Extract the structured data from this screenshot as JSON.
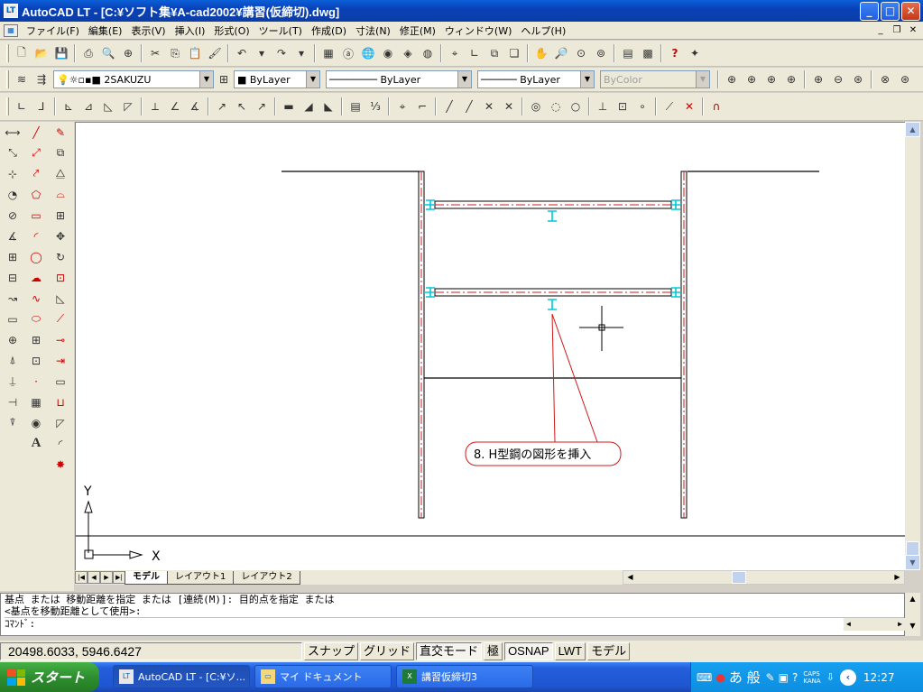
{
  "window": {
    "icon_label": "LT",
    "title": "AutoCAD LT - [C:¥ソフト集¥A-cad2002¥講習(仮締切).dwg]",
    "minimize": "_",
    "maximize": "□",
    "close": "✕"
  },
  "menu": {
    "items": [
      "ファイル(F)",
      "編集(E)",
      "表示(V)",
      "挿入(I)",
      "形式(O)",
      "ツール(T)",
      "作成(D)",
      "寸法(N)",
      "修正(M)",
      "ウィンドウ(W)",
      "ヘルプ(H)"
    ],
    "mdi_minimize": "_",
    "mdi_restore": "❐",
    "mdi_close": "✕"
  },
  "layers": {
    "current_layer": "2SAKUZU",
    "color": "ByLayer",
    "linetype": "ByLayer",
    "lineweight": "ByLayer",
    "plotstyle": "ByColor"
  },
  "drawing": {
    "callout_text": "8. H型鋼の図形を挿入",
    "ucs_y_label": "Y",
    "ucs_x_label": "X",
    "colors": {
      "outline": "#000000",
      "sheet_pile": "#d01818",
      "beam_accent": "#00c8d8",
      "callout": "#d01818"
    }
  },
  "tabs": {
    "model": "モデル",
    "layout1": "レイアウト1",
    "layout2": "レイアウト2"
  },
  "command": {
    "line1": "基点 または 移動距離を指定 または [連続(M)]: 目的点を指定 または",
    "line2": "<基点を移動距離として使用>:",
    "prompt": "ｺﾏﾝﾄﾞ:"
  },
  "status": {
    "coordinates": "20498.6033, 5946.6427",
    "toggles": [
      {
        "label": "スナップ",
        "on": false
      },
      {
        "label": "グリッド",
        "on": false
      },
      {
        "label": "直交モード",
        "on": true
      },
      {
        "label": "極",
        "on": false
      },
      {
        "label": "OSNAP",
        "on": true
      },
      {
        "label": "LWT",
        "on": false
      },
      {
        "label": "モデル",
        "on": false
      }
    ]
  },
  "taskbar": {
    "start": "スタート",
    "buttons": [
      "AutoCAD LT - [C:¥ソ...",
      "マイ ドキュメント",
      "講習仮締切3"
    ],
    "ime": "あ 般",
    "caps": "CAPS",
    "kana": "KANA",
    "clock": "12:27"
  }
}
